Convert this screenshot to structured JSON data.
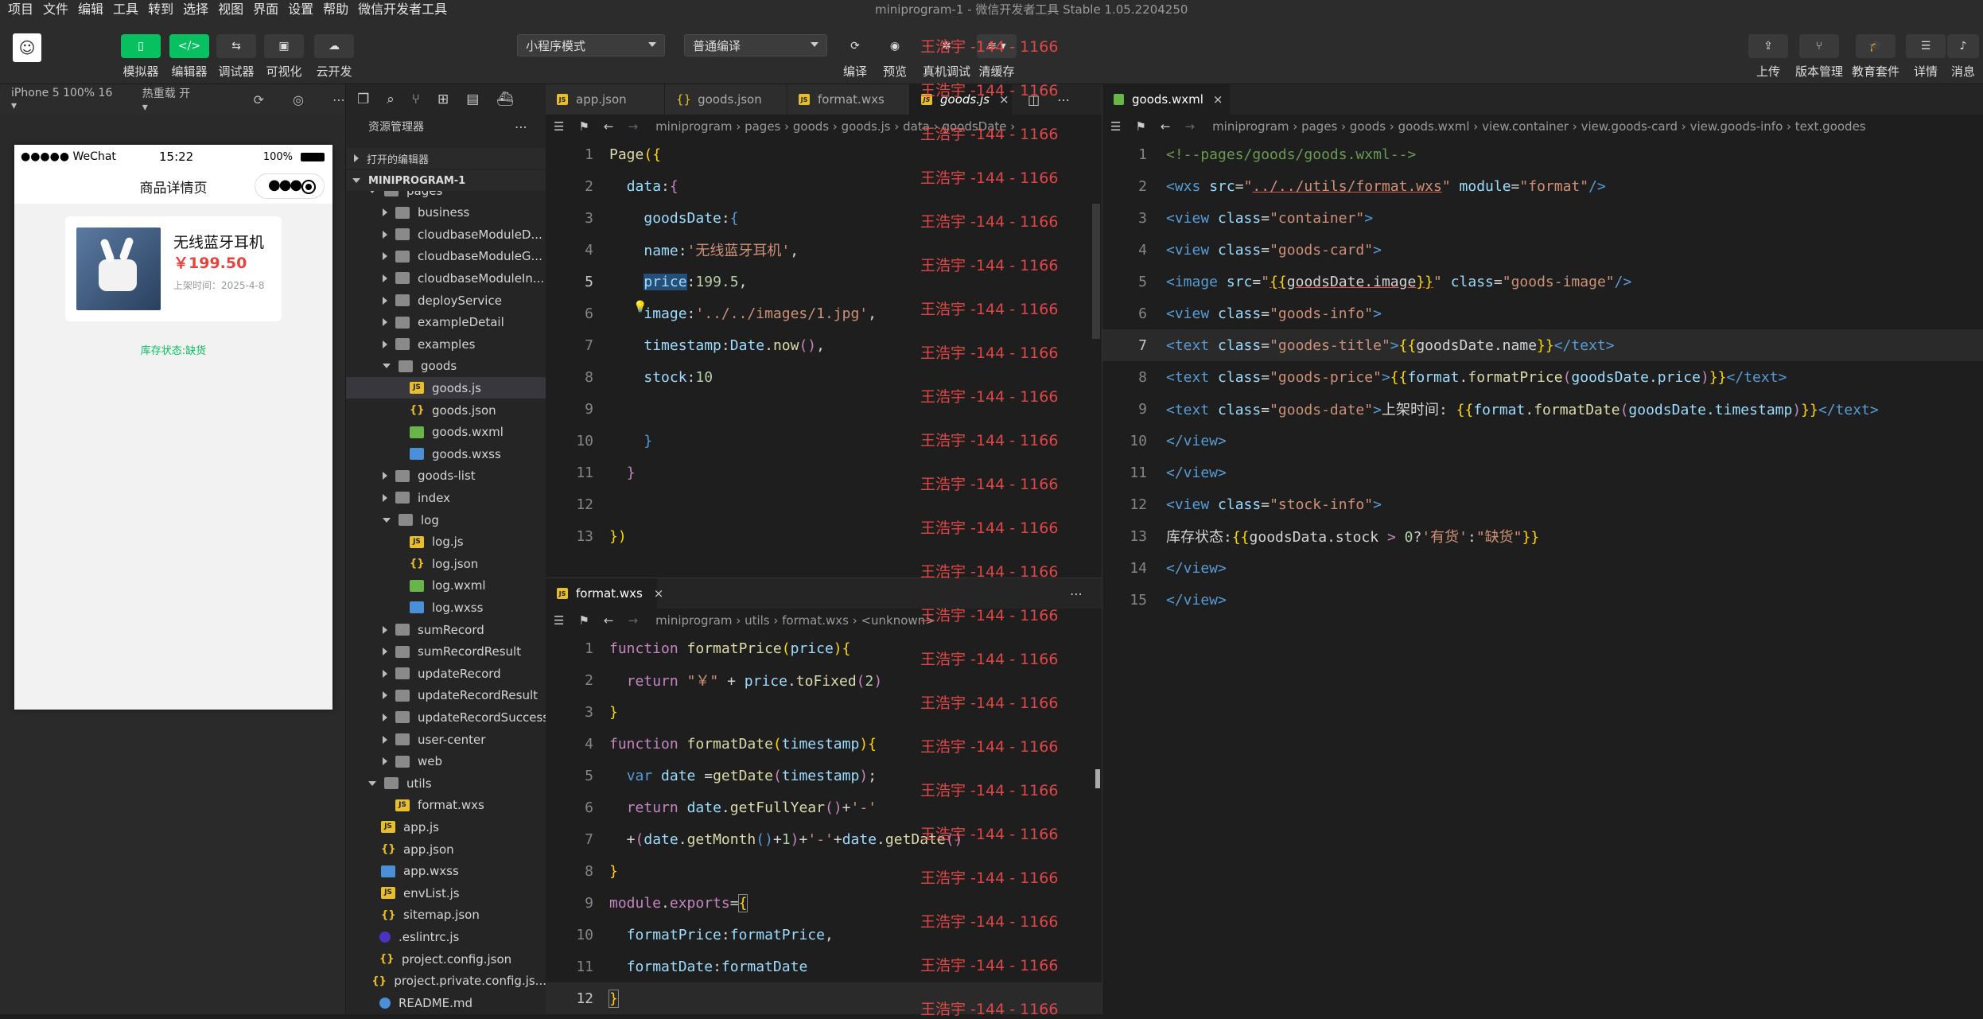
{
  "menu": [
    "项目",
    "文件",
    "编辑",
    "工具",
    "转到",
    "选择",
    "视图",
    "界面",
    "设置",
    "帮助",
    "微信开发者工具"
  ],
  "window_title": "miniprogram-1 - 微信开发者工具 Stable 1.05.2204250",
  "toolbar": {
    "simulator": "模拟器",
    "editor": "编辑器",
    "debugger": "调试器",
    "visual": "可视化",
    "cloud": "云开发",
    "mode_select": "小程序模式",
    "compile_select": "普通编译",
    "compile": "编译",
    "preview": "预览",
    "real_debug": "真机调试",
    "clear_cache": "清缓存",
    "upload": "上传",
    "version": "版本管理",
    "edu": "教育套件",
    "details": "详情",
    "messages": "消息"
  },
  "simbar": {
    "device": "iPhone 5 100% 16 ▾",
    "hot_reload": "热重载 开 ▾"
  },
  "phone": {
    "carrier": "●●●●● WeChat",
    "time": "15:22",
    "battery": "100%",
    "nav_title": "商品详情页",
    "goods_title": "无线蓝牙耳机",
    "goods_price": "￥199.50",
    "goods_date": "上架时间：2025-4-8",
    "stock_info": "库存状态:缺货"
  },
  "explorer": {
    "title": "资源管理器",
    "open_editors": "打开的编辑器",
    "project": "MINIPROGRAM-1",
    "rows": [
      {
        "label": "pages",
        "type": "folder",
        "indent": 0,
        "chev": "d"
      },
      {
        "label": "business",
        "type": "folder",
        "indent": 1,
        "chev": "r"
      },
      {
        "label": "cloudbaseModuleD...",
        "type": "folder",
        "indent": 1,
        "chev": "r"
      },
      {
        "label": "cloudbaseModuleG...",
        "type": "folder",
        "indent": 1,
        "chev": "r"
      },
      {
        "label": "cloudbaseModuleIn...",
        "type": "folder",
        "indent": 1,
        "chev": "r"
      },
      {
        "label": "deployService",
        "type": "folder",
        "indent": 1,
        "chev": "r"
      },
      {
        "label": "exampleDetail",
        "type": "folder",
        "indent": 1,
        "chev": "r"
      },
      {
        "label": "examples",
        "type": "folder",
        "indent": 1,
        "chev": "r"
      },
      {
        "label": "goods",
        "type": "folder",
        "indent": 1,
        "chev": "d"
      },
      {
        "label": "goods.js",
        "type": "js",
        "indent": 2,
        "chev": "",
        "selected": true
      },
      {
        "label": "goods.json",
        "type": "json",
        "indent": 2,
        "chev": ""
      },
      {
        "label": "goods.wxml",
        "type": "wxml",
        "indent": 2,
        "chev": ""
      },
      {
        "label": "goods.wxss",
        "type": "wxss",
        "indent": 2,
        "chev": ""
      },
      {
        "label": "goods-list",
        "type": "folder",
        "indent": 1,
        "chev": "r"
      },
      {
        "label": "index",
        "type": "folder",
        "indent": 1,
        "chev": "r"
      },
      {
        "label": "log",
        "type": "folder",
        "indent": 1,
        "chev": "d"
      },
      {
        "label": "log.js",
        "type": "js",
        "indent": 2,
        "chev": ""
      },
      {
        "label": "log.json",
        "type": "json",
        "indent": 2,
        "chev": ""
      },
      {
        "label": "log.wxml",
        "type": "wxml",
        "indent": 2,
        "chev": ""
      },
      {
        "label": "log.wxss",
        "type": "wxss",
        "indent": 2,
        "chev": ""
      },
      {
        "label": "sumRecord",
        "type": "folder",
        "indent": 1,
        "chev": "r"
      },
      {
        "label": "sumRecordResult",
        "type": "folder",
        "indent": 1,
        "chev": "r"
      },
      {
        "label": "updateRecord",
        "type": "folder",
        "indent": 1,
        "chev": "r"
      },
      {
        "label": "updateRecordResult",
        "type": "folder",
        "indent": 1,
        "chev": "r"
      },
      {
        "label": "updateRecordSuccess",
        "type": "folder",
        "indent": 1,
        "chev": "r"
      },
      {
        "label": "user-center",
        "type": "folder",
        "indent": 1,
        "chev": "r"
      },
      {
        "label": "web",
        "type": "folder",
        "indent": 1,
        "chev": "r"
      },
      {
        "label": "utils",
        "type": "folder",
        "indent": 0,
        "chev": "d"
      },
      {
        "label": "format.wxs",
        "type": "js",
        "indent": 1,
        "chev": ""
      },
      {
        "label": "app.js",
        "type": "js",
        "indent": 0,
        "chev": ""
      },
      {
        "label": "app.json",
        "type": "json",
        "indent": 0,
        "chev": ""
      },
      {
        "label": "app.wxss",
        "type": "wxss",
        "indent": 0,
        "chev": ""
      },
      {
        "label": "envList.js",
        "type": "js",
        "indent": 0,
        "chev": ""
      },
      {
        "label": "sitemap.json",
        "type": "json",
        "indent": 0,
        "chev": ""
      },
      {
        "label": ".eslintrc.js",
        "type": "eslint",
        "indent": -1,
        "chev": ""
      },
      {
        "label": "project.config.json",
        "type": "json",
        "indent": -1,
        "chev": ""
      },
      {
        "label": "project.private.config.js...",
        "type": "json",
        "indent": -1,
        "chev": ""
      },
      {
        "label": "README.md",
        "type": "readme",
        "indent": -1,
        "chev": ""
      }
    ]
  },
  "editor_top": {
    "tabs": [
      "app.json",
      "goods.json",
      "format.wxs",
      "goods.js"
    ],
    "breadcrumb": "miniprogram  ›  pages  ›  goods  ›  goods.js  ›  data  ›  goodsDate  ›",
    "active_line": "5"
  },
  "editor_bottom": {
    "tab": "format.wxs",
    "breadcrumb": "miniprogram  ›  utils  ›  format.wxs  ›  <unknown>",
    "active_line": "12"
  },
  "editor_right": {
    "tab": "goods.wxml",
    "breadcrumb": "miniprogram  ›  pages  ›  goods  ›  goods.wxml  ›  view.container  ›  view.goods-card  ›  view.goods-info  ›  text.goodes",
    "active_line": "7"
  },
  "watermark": "王浩宇 -144 - 1166"
}
